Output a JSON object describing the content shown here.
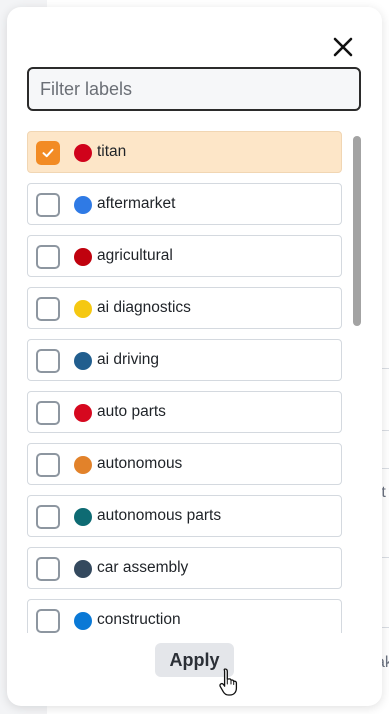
{
  "filter": {
    "placeholder": "Filter labels",
    "value": ""
  },
  "labels": [
    {
      "name": "titan",
      "color": "#d0021b",
      "checked": true
    },
    {
      "name": "aftermarket",
      "color": "#2f7ae5",
      "checked": false
    },
    {
      "name": "agricultural",
      "color": "#c0020e",
      "checked": false
    },
    {
      "name": "ai diagnostics",
      "color": "#f5c811",
      "checked": false
    },
    {
      "name": "ai driving",
      "color": "#215e8e",
      "checked": false
    },
    {
      "name": "auto parts",
      "color": "#d6081f",
      "checked": false
    },
    {
      "name": "autonomous",
      "color": "#e2822a",
      "checked": false
    },
    {
      "name": "autonomous parts",
      "color": "#0e6b73",
      "checked": false
    },
    {
      "name": "car assembly",
      "color": "#34495e",
      "checked": false
    },
    {
      "name": "construction",
      "color": "#0a79d6",
      "checked": false
    }
  ],
  "footer": {
    "apply_label": "Apply"
  },
  "background": {
    "fragment_1": "rt",
    "fragment_2": "ak"
  },
  "icons": {
    "close": "close-icon",
    "check": "checkmark-icon",
    "cursor": "hand-pointer-icon"
  }
}
